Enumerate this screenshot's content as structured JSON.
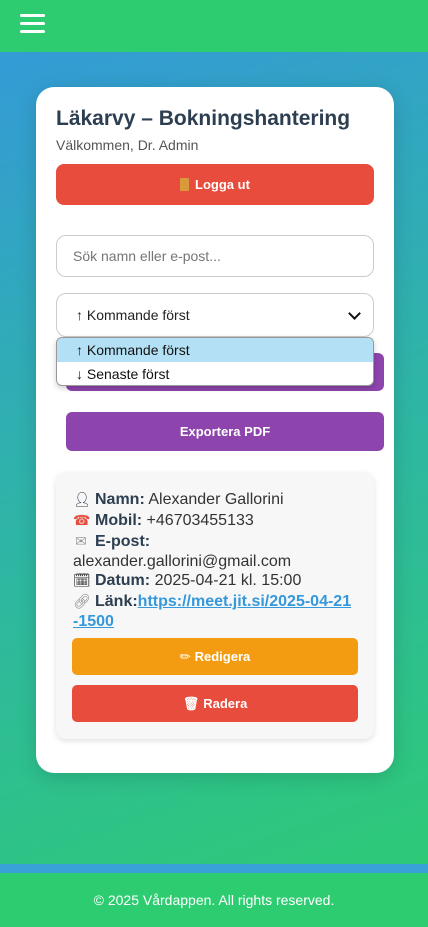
{
  "header": {
    "menu_icon": "hamburger-icon"
  },
  "card": {
    "title": "Läkarvy – Bokningshantering",
    "welcome": "Välkommen, Dr. Admin",
    "logout_icon": "door-icon",
    "logout_label": "Logga ut",
    "search_placeholder": "Sök namn eller e-post...",
    "sort": {
      "selected": "↑ Kommande först",
      "options": [
        "↑ Kommande först",
        "↓ Senaste först"
      ]
    },
    "export_label": "Exportera PDF"
  },
  "booking": {
    "name_label": "Namn:",
    "name": "Alexander Gallorini",
    "phone_label": "Mobil:",
    "phone": "+46703455133",
    "email_label": "E-post:",
    "email": "alexander.gallorini@gmail.com",
    "date_label": "Datum:",
    "date": "2025-04-21 kl. 15:00",
    "link_label": "Länk:",
    "link_line1": "https://meet.jit.si/2025-04-21",
    "link_line2": "-1500",
    "edit_label": "Redigera",
    "delete_label": "Radera",
    "icons": [
      "person-icon",
      "phone-icon",
      "envelope-icon",
      "calendar-icon",
      "link-icon",
      "pencil-icon",
      "trash-icon"
    ]
  },
  "footer": {
    "text": "© 2025 Vårdappen. All rights reserved."
  },
  "colors": {
    "primary_green": "#2ecc71",
    "danger_red": "#e74c3c",
    "purple": "#8e44ad",
    "orange": "#f39c12",
    "link_blue": "#3498db"
  }
}
